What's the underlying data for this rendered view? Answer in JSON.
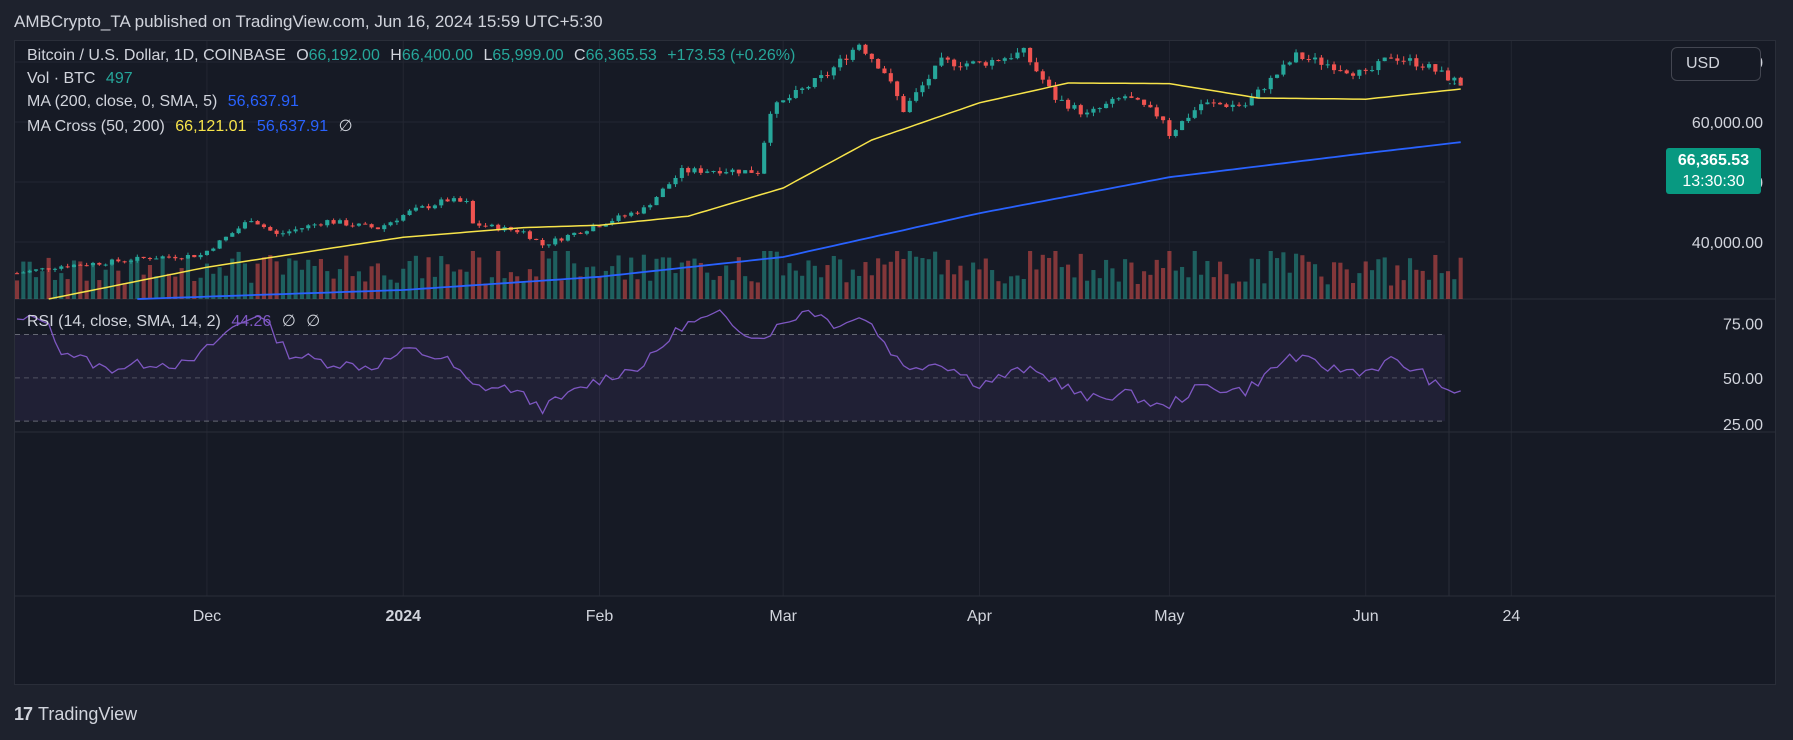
{
  "header": {
    "published": "AMBCrypto_TA published on TradingView.com, Jun 16, 2024 15:59 UTC+5:30"
  },
  "legend": {
    "symbol": "Bitcoin / U.S. Dollar, 1D, COINBASE",
    "o_label": "O",
    "o_value": "66,192.00",
    "h_label": "H",
    "h_value": "66,400.00",
    "l_label": "L",
    "l_value": "65,999.00",
    "c_label": "C",
    "c_value": "66,365.53",
    "change": "+173.53 (+0.26%)",
    "vol_label": "Vol · BTC",
    "vol_value": "497",
    "ma_label": "MA (200, close, 0, SMA, 5)",
    "ma_value": "56,637.91",
    "cross_label": "MA Cross (50, 200)",
    "cross_fast": "66,121.01",
    "cross_slow": "56,637.91",
    "cross_sym": "∅",
    "rsi_label": "RSI (14, close, SMA, 14, 2)",
    "rsi_value": "44.26",
    "rsi_sym1": "∅",
    "rsi_sym2": "∅"
  },
  "currency_button": "USD",
  "price_tag": {
    "price": "66,365.53",
    "countdown": "13:30:30"
  },
  "footer": {
    "brand": "TradingView",
    "logo": "17"
  },
  "colors": {
    "up": "#26a69a",
    "down": "#ef5350",
    "ma200": "#2962ff",
    "ma50": "#f7e44a",
    "rsi": "#7e57c2",
    "background": "#161a25"
  },
  "chart_data": [
    {
      "type": "candlestick",
      "title": "Bitcoin / U.S. Dollar, 1D, COINBASE",
      "y_ticks": [
        40000,
        50000,
        60000,
        70000
      ],
      "y_tick_labels": [
        "40,000.00",
        "50,000.00",
        "60,000.00",
        "70,000.00"
      ],
      "ylim": [
        30500,
        73500
      ],
      "x_tick_labels": [
        "Dec",
        "2024",
        "Feb",
        "Mar",
        "Apr",
        "May",
        "Jun",
        "24"
      ],
      "x_tick_dates": [
        "2023-12-01",
        "2024-01-01",
        "2024-02-01",
        "2024-03-01",
        "2024-04-01",
        "2024-05-01",
        "2024-06-01",
        "2024-06-24"
      ],
      "xlim": [
        "2023-11-01",
        "2024-06-29"
      ],
      "close_path": [
        [
          "2023-11-01",
          34800
        ],
        [
          "2023-11-08",
          36000
        ],
        [
          "2023-11-15",
          36600
        ],
        [
          "2023-11-22",
          37400
        ],
        [
          "2023-11-30",
          37800
        ],
        [
          "2023-12-05",
          41500
        ],
        [
          "2023-12-08",
          43900
        ],
        [
          "2023-12-12",
          41200
        ],
        [
          "2023-12-20",
          43500
        ],
        [
          "2023-12-28",
          42300
        ],
        [
          "2024-01-02",
          45000
        ],
        [
          "2024-01-08",
          47000
        ],
        [
          "2024-01-11",
          46500
        ],
        [
          "2024-01-12",
          43000
        ],
        [
          "2024-01-20",
          41700
        ],
        [
          "2024-01-23",
          39500
        ],
        [
          "2024-01-31",
          42600
        ],
        [
          "2024-02-08",
          45500
        ],
        [
          "2024-02-14",
          51800
        ],
        [
          "2024-02-20",
          52000
        ],
        [
          "2024-02-26",
          51700
        ],
        [
          "2024-02-28",
          62000
        ],
        [
          "2024-03-05",
          66000
        ],
        [
          "2024-03-08",
          68000
        ],
        [
          "2024-03-13",
          73100
        ],
        [
          "2024-03-17",
          68400
        ],
        [
          "2024-03-20",
          62000
        ],
        [
          "2024-03-26",
          70000
        ],
        [
          "2024-04-01",
          69700
        ],
        [
          "2024-04-08",
          71600
        ],
        [
          "2024-04-13",
          64000
        ],
        [
          "2024-04-18",
          61200
        ],
        [
          "2024-04-24",
          64300
        ],
        [
          "2024-04-30",
          60600
        ],
        [
          "2024-05-01",
          58000
        ],
        [
          "2024-05-06",
          63000
        ],
        [
          "2024-05-13",
          62800
        ],
        [
          "2024-05-16",
          66000
        ],
        [
          "2024-05-21",
          71000
        ],
        [
          "2024-05-27",
          69400
        ],
        [
          "2024-06-01",
          67800
        ],
        [
          "2024-06-05",
          71000
        ],
        [
          "2024-06-10",
          69600
        ],
        [
          "2024-06-16",
          66365
        ]
      ],
      "ma50_path": [
        [
          "2023-11-06",
          30500
        ],
        [
          "2023-12-01",
          35800
        ],
        [
          "2024-01-01",
          40800
        ],
        [
          "2024-01-20",
          42400
        ],
        [
          "2024-02-01",
          42800
        ],
        [
          "2024-02-15",
          44300
        ],
        [
          "2024-03-01",
          49000
        ],
        [
          "2024-03-15",
          57000
        ],
        [
          "2024-04-01",
          63200
        ],
        [
          "2024-04-15",
          66500
        ],
        [
          "2024-05-01",
          66400
        ],
        [
          "2024-05-15",
          64000
        ],
        [
          "2024-06-01",
          63800
        ],
        [
          "2024-06-16",
          65500
        ]
      ],
      "ma200_path": [
        [
          "2023-11-20",
          30500
        ],
        [
          "2024-01-01",
          32000
        ],
        [
          "2024-02-01",
          34200
        ],
        [
          "2024-03-01",
          37500
        ],
        [
          "2024-04-01",
          44800
        ],
        [
          "2024-05-01",
          50800
        ],
        [
          "2024-06-01",
          54800
        ],
        [
          "2024-06-16",
          56637
        ]
      ],
      "volume_scale_max": 30000
    },
    {
      "type": "line",
      "title": "RSI (14, close, SMA, 14, 2)",
      "y_ticks": [
        25,
        50,
        75
      ],
      "y_tick_labels": [
        "25.00",
        "50.00",
        "75.00"
      ],
      "ylim": [
        25,
        85
      ],
      "band": [
        30,
        70
      ],
      "midline": 50,
      "values_path": [
        [
          "2023-11-01",
          76
        ],
        [
          "2023-11-05",
          78
        ],
        [
          "2023-11-08",
          63
        ],
        [
          "2023-11-15",
          54
        ],
        [
          "2023-11-22",
          57
        ],
        [
          "2023-11-28",
          56
        ],
        [
          "2023-12-05",
          73
        ],
        [
          "2023-12-09",
          80
        ],
        [
          "2023-12-14",
          61
        ],
        [
          "2023-12-20",
          57
        ],
        [
          "2023-12-27",
          55
        ],
        [
          "2024-01-02",
          63
        ],
        [
          "2024-01-08",
          58
        ],
        [
          "2024-01-12",
          46
        ],
        [
          "2024-01-18",
          45
        ],
        [
          "2024-01-23",
          36
        ],
        [
          "2024-01-31",
          48
        ],
        [
          "2024-02-08",
          56
        ],
        [
          "2024-02-14",
          74
        ],
        [
          "2024-02-20",
          79
        ],
        [
          "2024-02-26",
          68
        ],
        [
          "2024-03-05",
          82
        ],
        [
          "2024-03-09",
          75
        ],
        [
          "2024-03-14",
          78
        ],
        [
          "2024-03-20",
          55
        ],
        [
          "2024-03-26",
          57
        ],
        [
          "2024-04-01",
          47
        ],
        [
          "2024-04-08",
          54
        ],
        [
          "2024-04-13",
          49
        ],
        [
          "2024-04-18",
          40
        ],
        [
          "2024-04-24",
          43
        ],
        [
          "2024-04-30",
          36
        ],
        [
          "2024-05-06",
          46
        ],
        [
          "2024-05-13",
          44
        ],
        [
          "2024-05-20",
          60
        ],
        [
          "2024-05-27",
          54
        ],
        [
          "2024-06-01",
          53
        ],
        [
          "2024-06-05",
          58
        ],
        [
          "2024-06-10",
          52
        ],
        [
          "2024-06-13",
          44
        ],
        [
          "2024-06-16",
          44.26
        ]
      ]
    }
  ]
}
